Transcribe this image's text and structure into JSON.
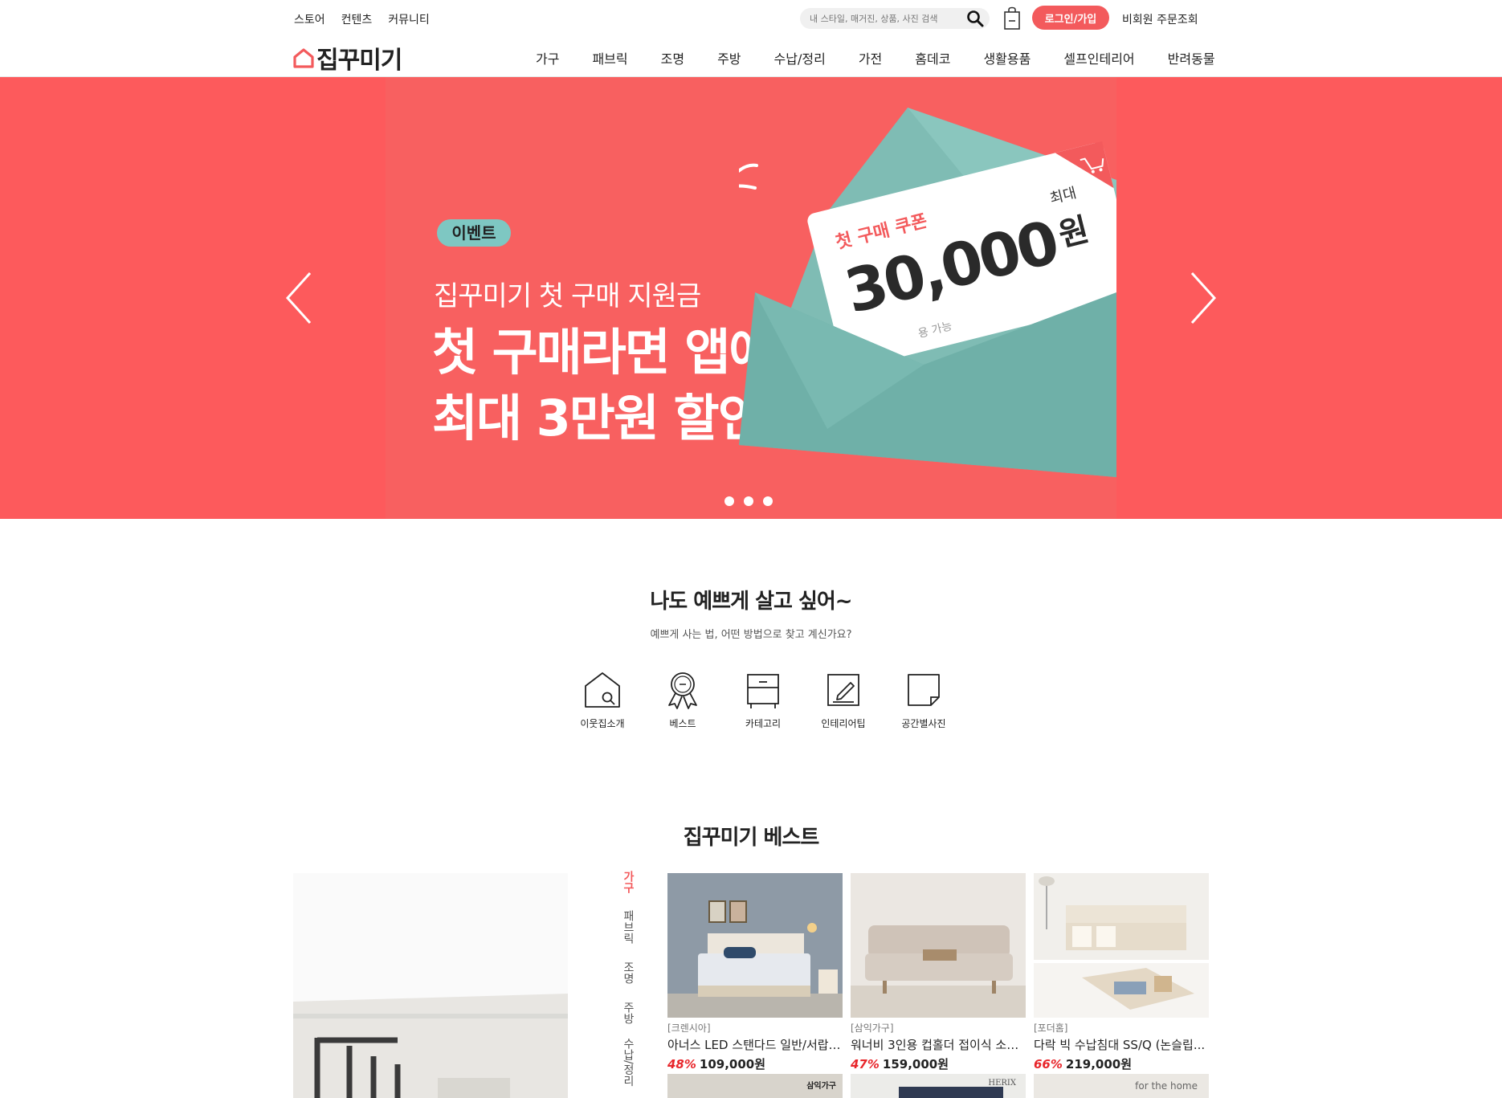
{
  "header": {
    "util_links": [
      "스토어",
      "컨텐츠",
      "커뮤니티"
    ],
    "search_placeholder": "내 스타일, 매거진, 상품, 사진 검색",
    "login_label": "로그인/가입",
    "guest_order_label": "비회원 주문조회",
    "logo_text": "집꾸미기",
    "nav": [
      "가구",
      "패브릭",
      "조명",
      "주방",
      "수납/정리",
      "가전",
      "홈데코",
      "생활용품",
      "셀프인테리어",
      "반려동물"
    ]
  },
  "hero": {
    "badge": "이벤트",
    "subtitle": "집꾸미기 첫 구매 지원금",
    "title_line1": "첫 구매라면 앱에서",
    "title_line2": "최대 3만원 할인",
    "coupon_label": "첫 구매 쿠폰",
    "coupon_max": "최대",
    "coupon_amount": "30,000",
    "coupon_unit": "원",
    "coupon_note": "용 가능",
    "slide_count": 3
  },
  "shop_section": {
    "title": "나도 예쁘게 살고 싶어~",
    "subtitle": "예쁘게 사는 법, 어떤 방법으로 찾고 계신가요?",
    "items": [
      {
        "label": "이웃집소개",
        "icon": "house-search-icon"
      },
      {
        "label": "베스트",
        "icon": "award-ribbon-icon"
      },
      {
        "label": "카테고리",
        "icon": "drawer-cabinet-icon"
      },
      {
        "label": "인테리어팁",
        "icon": "edit-note-icon"
      },
      {
        "label": "공간별사진",
        "icon": "folded-page-icon"
      }
    ]
  },
  "best_section": {
    "title": "집꾸미기 베스트",
    "side_categories": [
      "가구",
      "패브릭",
      "조명",
      "주방",
      "수납/정리"
    ],
    "products": [
      {
        "brand": "[크렌시아]",
        "name": "아너스 LED 스탠다드 일반/서랍 ...",
        "discount": "48%",
        "price": "109,000원"
      },
      {
        "brand": "[삼익가구]",
        "name": "워너비 3인용 컵홀더 접이식 소파...",
        "discount": "47%",
        "price": "159,000원"
      },
      {
        "brand": "[포더홈]",
        "name": "다락 빅 수납침대 SS/Q (논슬립...",
        "discount": "66%",
        "price": "219,000원"
      }
    ],
    "next_row_labels": [
      "삼익가구",
      "HERIX",
      "for the home"
    ]
  },
  "colors": {
    "accent": "#f35a5c",
    "hero_bg": "#fd5a5c",
    "badge_bg": "#7ec7c2",
    "discount": "#e8262b"
  }
}
